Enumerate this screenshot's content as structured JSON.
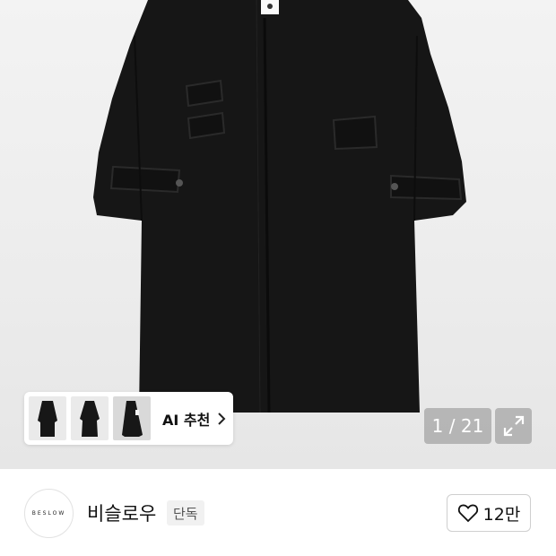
{
  "product_image": {
    "alt_subject": "coat",
    "ai_recommendation": {
      "label": "AI 추천",
      "thumbnails": 3
    },
    "page_counter": "1 / 21"
  },
  "brand": {
    "logo_text": "BESLOW",
    "name": "비슬로우",
    "badge": "단독",
    "likes": "12만"
  },
  "colors": {
    "coat": "#161616",
    "overlay": "#8c8c8c"
  }
}
